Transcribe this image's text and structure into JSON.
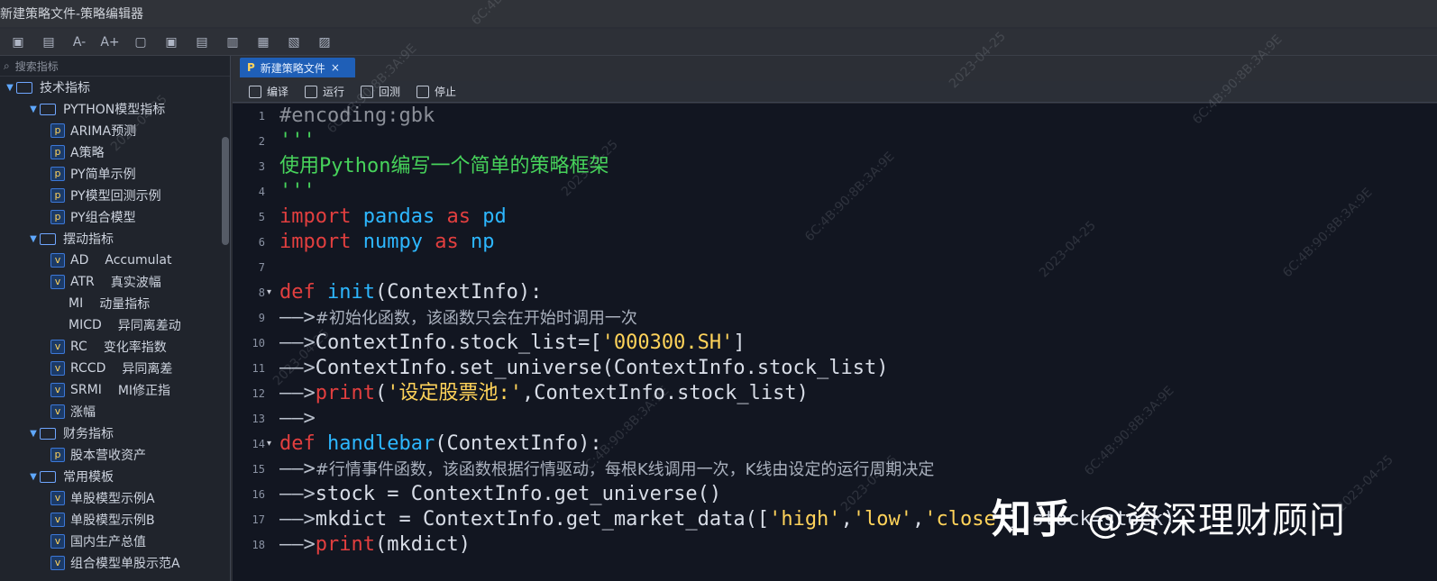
{
  "window": {
    "title": "新建策略文件-策略编辑器"
  },
  "toolbar": {
    "icons": [
      {
        "name": "new-file-icon",
        "glyph": "▣"
      },
      {
        "name": "save-icon",
        "glyph": "▤"
      },
      {
        "name": "font-decrease-icon",
        "glyph": "A-"
      },
      {
        "name": "font-increase-icon",
        "glyph": "A+"
      },
      {
        "name": "tool1-icon",
        "glyph": "▢"
      },
      {
        "name": "tool2-icon",
        "glyph": "▣"
      },
      {
        "name": "tool3-icon",
        "glyph": "▤"
      },
      {
        "name": "tool4-icon",
        "glyph": "▥"
      },
      {
        "name": "tool5-icon",
        "glyph": "▦"
      },
      {
        "name": "tool6-icon",
        "glyph": "▧"
      },
      {
        "name": "tool7-icon",
        "glyph": "▨"
      }
    ]
  },
  "left_panel": {
    "search_placeholder": "搜索指标",
    "tree": [
      {
        "level": 0,
        "type": "folder",
        "label": "技术指标",
        "expanded": true
      },
      {
        "level": 1,
        "type": "folder",
        "label": "PYTHON模型指标",
        "expanded": true
      },
      {
        "level": 2,
        "type": "py",
        "label": "ARIMA预测"
      },
      {
        "level": 2,
        "type": "py",
        "label": "A策略"
      },
      {
        "level": 2,
        "type": "py",
        "label": "PY简单示例"
      },
      {
        "level": 2,
        "type": "py",
        "label": "PY模型回测示例"
      },
      {
        "level": 2,
        "type": "py",
        "label": "PY组合模型"
      },
      {
        "level": 1,
        "type": "folder",
        "label": "摆动指标",
        "expanded": true
      },
      {
        "level": 2,
        "type": "ind",
        "label": "AD",
        "desc": "Accumulat"
      },
      {
        "level": 2,
        "type": "ind",
        "label": "ATR",
        "desc": "真实波幅"
      },
      {
        "level": 2,
        "type": "plain",
        "label": "MI",
        "desc": "动量指标"
      },
      {
        "level": 2,
        "type": "plain",
        "label": "MICD",
        "desc": "异同离差动"
      },
      {
        "level": 2,
        "type": "ind",
        "label": "RC",
        "desc": "变化率指数"
      },
      {
        "level": 2,
        "type": "ind",
        "label": "RCCD",
        "desc": "异同离差"
      },
      {
        "level": 2,
        "type": "ind",
        "label": "SRMI",
        "desc": "MI修正指"
      },
      {
        "level": 2,
        "type": "ind",
        "label": "涨幅"
      },
      {
        "level": 1,
        "type": "folder",
        "label": "财务指标",
        "expanded": true
      },
      {
        "level": 2,
        "type": "py",
        "label": "股本营收资产"
      },
      {
        "level": 1,
        "type": "folder",
        "label": "常用模板",
        "expanded": true
      },
      {
        "level": 2,
        "type": "ind",
        "label": "单股模型示例A"
      },
      {
        "level": 2,
        "type": "ind",
        "label": "单股模型示例B"
      },
      {
        "level": 2,
        "type": "ind",
        "label": "国内生产总值"
      },
      {
        "level": 2,
        "type": "ind",
        "label": "组合模型单股示范A"
      }
    ]
  },
  "tab": {
    "label": "新建策略文件",
    "close": "×"
  },
  "actions": {
    "compile": "编译",
    "run": "运行",
    "backtest": "回测",
    "stop": "停止"
  },
  "editor": {
    "line_numbers": [
      1,
      2,
      3,
      4,
      5,
      6,
      7,
      8,
      9,
      10,
      11,
      12,
      13,
      14,
      15,
      16,
      17,
      18
    ],
    "fold_lines": [
      8,
      14
    ],
    "lines": [
      {
        "segments": [
          {
            "t": "#encoding:gbk",
            "c": "comment"
          }
        ]
      },
      {
        "segments": [
          {
            "t": "'''",
            "c": "green"
          }
        ]
      },
      {
        "segments": [
          {
            "t": "使用Python编写一个简单的策略框架",
            "c": "green"
          }
        ]
      },
      {
        "segments": [
          {
            "t": "'''",
            "c": "green"
          }
        ]
      },
      {
        "segments": [
          {
            "t": "import",
            "c": "kw"
          },
          {
            "t": " pandas ",
            "c": "mod"
          },
          {
            "t": "as",
            "c": "kw"
          },
          {
            "t": " pd",
            "c": "mod"
          }
        ]
      },
      {
        "segments": [
          {
            "t": "import",
            "c": "kw"
          },
          {
            "t": " numpy ",
            "c": "mod"
          },
          {
            "t": "as",
            "c": "kw"
          },
          {
            "t": " np",
            "c": "mod"
          }
        ]
      },
      {
        "segments": []
      },
      {
        "segments": [
          {
            "t": "def",
            "c": "kw"
          },
          {
            "t": " init",
            "c": "fn"
          },
          {
            "t": "(ContextInfo):",
            "c": "text"
          }
        ]
      },
      {
        "segments": [
          {
            "t": "——>",
            "c": "arrow"
          },
          {
            "t": "#初始化函数，该函数只会在开始时调用一次",
            "c": "cn"
          }
        ]
      },
      {
        "segments": [
          {
            "t": "——>",
            "c": "arrow"
          },
          {
            "t": "ContextInfo.stock_list=[",
            "c": "text"
          },
          {
            "t": "'000300.SH'",
            "c": "str"
          },
          {
            "t": "]",
            "c": "text"
          }
        ]
      },
      {
        "segments": [
          {
            "t": "——>",
            "c": "arrow"
          },
          {
            "t": "ContextInfo.set_universe(ContextInfo.stock_list)",
            "c": "text"
          }
        ]
      },
      {
        "segments": [
          {
            "t": "——>",
            "c": "arrow"
          },
          {
            "t": "print",
            "c": "kw"
          },
          {
            "t": "(",
            "c": "text"
          },
          {
            "t": "'设定股票池:'",
            "c": "str"
          },
          {
            "t": ",ContextInfo.stock_list)",
            "c": "text"
          }
        ]
      },
      {
        "segments": [
          {
            "t": "——>",
            "c": "arrow"
          }
        ]
      },
      {
        "segments": [
          {
            "t": "def",
            "c": "kw"
          },
          {
            "t": " handlebar",
            "c": "fn"
          },
          {
            "t": "(ContextInfo):",
            "c": "text"
          }
        ]
      },
      {
        "segments": [
          {
            "t": "——>",
            "c": "arrow"
          },
          {
            "t": "#行情事件函数，该函数根据行情驱动，每根K线调用一次，K线由设定的运行周期决定",
            "c": "cn"
          }
        ]
      },
      {
        "segments": [
          {
            "t": "——>",
            "c": "arrow"
          },
          {
            "t": "stock = ContextInfo.get_universe()",
            "c": "text"
          }
        ]
      },
      {
        "segments": [
          {
            "t": "——>",
            "c": "arrow"
          },
          {
            "t": "mkdict = ContextInfo.get_market_data([",
            "c": "text"
          },
          {
            "t": "'high'",
            "c": "str"
          },
          {
            "t": ",",
            "c": "text"
          },
          {
            "t": "'low'",
            "c": "str"
          },
          {
            "t": ",",
            "c": "text"
          },
          {
            "t": "'close'",
            "c": "str"
          },
          {
            "t": "],stock=stock)",
            "c": "text"
          }
        ]
      },
      {
        "segments": [
          {
            "t": "——>",
            "c": "arrow"
          },
          {
            "t": "print",
            "c": "kw"
          },
          {
            "t": "(mkdict)",
            "c": "text"
          }
        ]
      }
    ]
  },
  "watermarks": {
    "mac": "6C:4B:90:8B:3A:9E",
    "date": "2023-04-25"
  },
  "brand": {
    "logo": "知乎",
    "handle": "@资深理财顾问"
  }
}
